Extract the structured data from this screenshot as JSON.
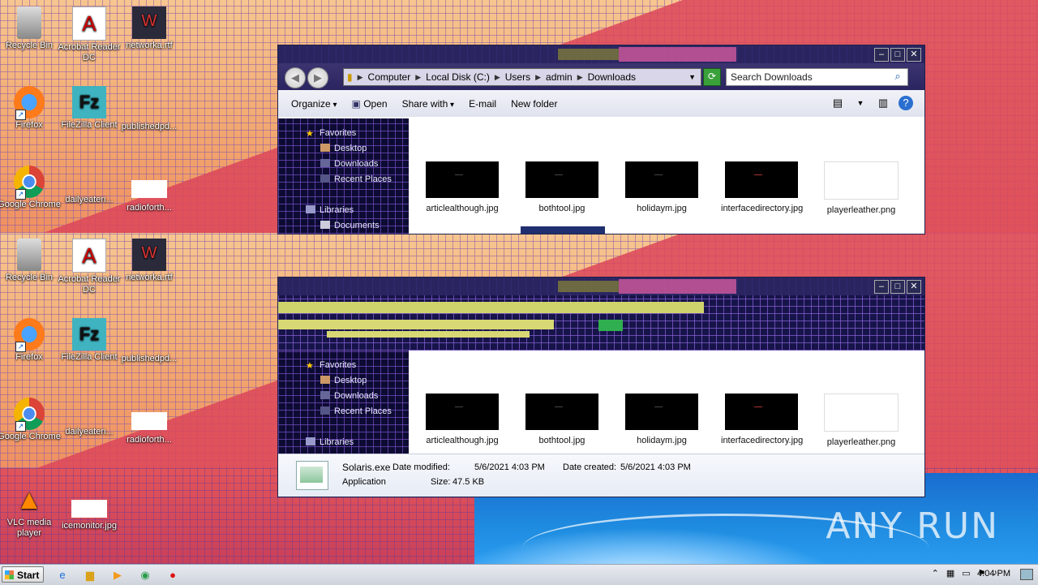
{
  "desktop": {
    "icons": [
      {
        "label": "Recycle Bin",
        "glyph": "🗑"
      },
      {
        "label": "Acrobat Reader DC",
        "glyph": "A"
      },
      {
        "label": "networka.rtf",
        "glyph": "W"
      },
      {
        "label": "Firefox",
        "glyph": "🦊"
      },
      {
        "label": "FileZilla Client",
        "glyph": "Fz"
      },
      {
        "label": "publishedpd...",
        "glyph": ""
      },
      {
        "label": "Google Chrome",
        "glyph": "◉"
      },
      {
        "label": "dailyeaten...",
        "glyph": ""
      },
      {
        "label": "radioforth...",
        "glyph": ""
      },
      {
        "label": "VLC media player",
        "glyph": "▲"
      },
      {
        "label": "icemonitor.jpg",
        "glyph": ""
      }
    ],
    "watermark": "ANY RUN"
  },
  "explorer": {
    "address": {
      "back_icon": "back-arrow",
      "forward_icon": "forward-arrow",
      "crumbs": [
        "Computer",
        "Local Disk (C:)",
        "Users",
        "admin",
        "Downloads"
      ],
      "search_placeholder": "Search Downloads"
    },
    "toolbar": {
      "organize": "Organize",
      "open": "Open",
      "share_with": "Share with",
      "email": "E-mail",
      "new_folder": "New folder"
    },
    "nav": {
      "favorites": "Favorites",
      "desktop": "Desktop",
      "downloads": "Downloads",
      "recent_places": "Recent Places",
      "libraries": "Libraries",
      "documents": "Documents"
    },
    "files": [
      {
        "name": "articlealthough.jpg",
        "style": "dark"
      },
      {
        "name": "bothtool.jpg",
        "style": "dark"
      },
      {
        "name": "holidaym.jpg",
        "style": "dark"
      },
      {
        "name": "interfacedirectory.jpg",
        "style": "dark"
      },
      {
        "name": "playerleather.png",
        "style": "light"
      }
    ],
    "details": {
      "filename": "Solaris.exe",
      "modified_label": "Date modified:",
      "modified": "5/6/2021 4:03 PM",
      "created_label": "Date created:",
      "created": "5/6/2021 4:03 PM",
      "type": "Application",
      "size_label": "Size:",
      "size": "47.5 KB"
    }
  },
  "taskbar": {
    "start_label": "Start",
    "clock": "4:04 PM"
  },
  "colors": {
    "nav_bg": "#0d0b33",
    "titlebar": "#2a2560",
    "accent_pink": "#c9579a"
  }
}
